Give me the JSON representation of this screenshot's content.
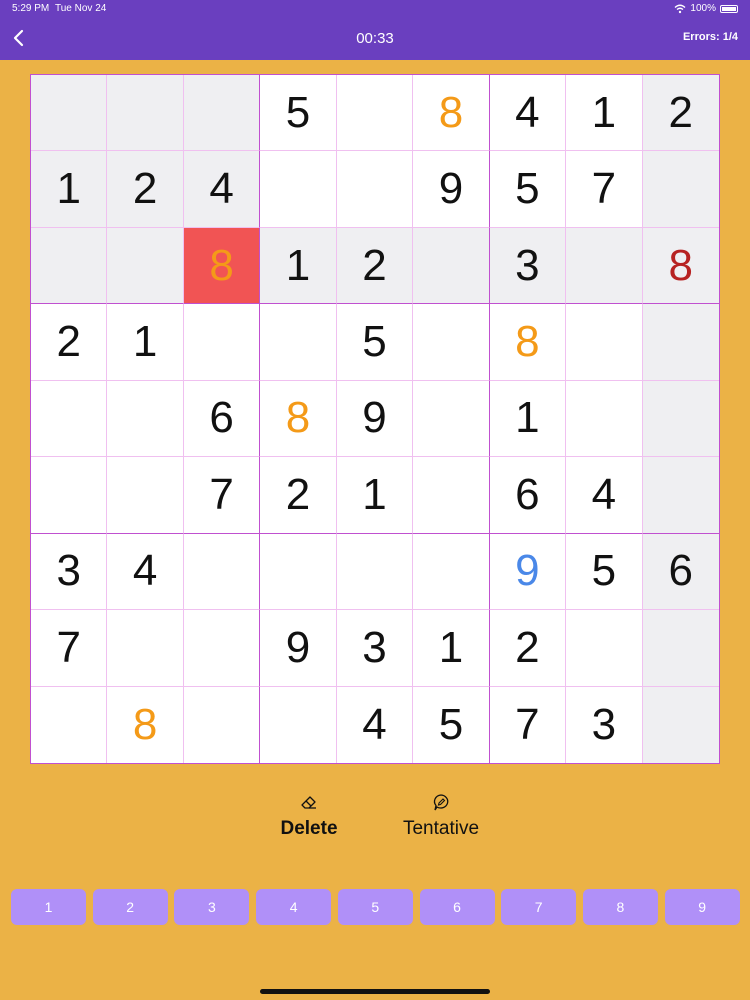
{
  "status": {
    "time": "5:29 PM",
    "date": "Tue Nov 24",
    "battery": "100%"
  },
  "header": {
    "timer": "00:33",
    "errors": "Errors: 1/4"
  },
  "board": {
    "cells": [
      [
        "",
        "",
        "",
        "5",
        "",
        "8",
        "4",
        "1",
        "2"
      ],
      [
        "1",
        "2",
        "4",
        "",
        "",
        "9",
        "5",
        "7",
        ""
      ],
      [
        "",
        "",
        "8",
        "1",
        "2",
        "",
        "3",
        "",
        "8"
      ],
      [
        "2",
        "1",
        "",
        "",
        "5",
        "",
        "8",
        "",
        ""
      ],
      [
        "",
        "",
        "6",
        "8",
        "9",
        "",
        "1",
        "",
        ""
      ],
      [
        "",
        "",
        "7",
        "2",
        "1",
        "",
        "6",
        "4",
        ""
      ],
      [
        "3",
        "4",
        "",
        "",
        "",
        "",
        "9",
        "5",
        "6"
      ],
      [
        "7",
        "",
        "",
        "9",
        "3",
        "1",
        "2",
        "",
        ""
      ],
      [
        "",
        "8",
        "",
        "",
        "4",
        "5",
        "7",
        "3",
        ""
      ]
    ],
    "selected_row": 2,
    "selected_col": 2,
    "error_cell": [
      2,
      2
    ],
    "colors": {
      "orange": "#f49a18",
      "red": "#b72222",
      "blue": "#4a88e8",
      "error_bg": "#f15454",
      "highlight_bg": "#efeff2"
    },
    "styled": {
      "0-5": "orange",
      "2-2": "orange",
      "2-8": "red",
      "3-6": "orange",
      "4-3": "orange",
      "6-6": "blue",
      "8-1": "orange"
    }
  },
  "tools": {
    "delete_label": "Delete",
    "tentative_label": "Tentative",
    "delete_icon": "eraser-icon",
    "tentative_icon": "pencil-bubble-icon"
  },
  "numpad": [
    "1",
    "2",
    "3",
    "4",
    "5",
    "6",
    "7",
    "8",
    "9"
  ],
  "theme": {
    "background": "#ebb246",
    "header": "#6a3fbf",
    "numpad": "#b090f8",
    "grid_major": "#c050d0"
  }
}
